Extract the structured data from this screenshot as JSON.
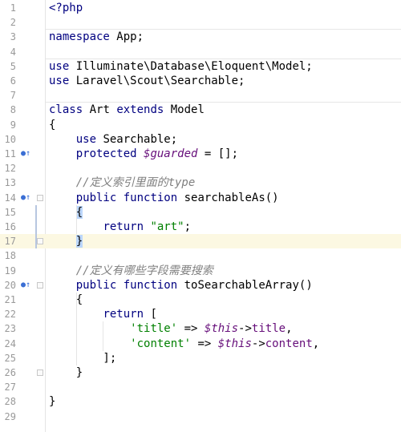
{
  "editor": {
    "current_line": 17,
    "lines": [
      {
        "n": "1",
        "tokens": [
          {
            "t": "<?php",
            "c": "kw"
          }
        ]
      },
      {
        "n": "2",
        "tokens": []
      },
      {
        "n": "3",
        "tokens": [
          {
            "t": "namespace",
            "c": "kw"
          },
          {
            "t": " App;",
            "c": ""
          }
        ]
      },
      {
        "n": "4",
        "tokens": []
      },
      {
        "n": "5",
        "tokens": [
          {
            "t": "use",
            "c": "kw"
          },
          {
            "t": " Illuminate\\Database\\Eloquent\\Model;",
            "c": ""
          }
        ]
      },
      {
        "n": "6",
        "tokens": [
          {
            "t": "use",
            "c": "kw"
          },
          {
            "t": " Laravel\\Scout\\Searchable;",
            "c": ""
          }
        ]
      },
      {
        "n": "7",
        "tokens": []
      },
      {
        "n": "8",
        "tokens": [
          {
            "t": "class",
            "c": "kw"
          },
          {
            "t": " Art ",
            "c": ""
          },
          {
            "t": "extends",
            "c": "kw"
          },
          {
            "t": " Model",
            "c": ""
          }
        ]
      },
      {
        "n": "9",
        "tokens": [
          {
            "t": "{",
            "c": ""
          }
        ]
      },
      {
        "n": "10",
        "tokens": [
          {
            "t": "    ",
            "c": ""
          },
          {
            "t": "use",
            "c": "kw"
          },
          {
            "t": " Searchable;",
            "c": ""
          }
        ]
      },
      {
        "n": "11",
        "marker": "override",
        "tokens": [
          {
            "t": "    ",
            "c": ""
          },
          {
            "t": "protected",
            "c": "kw"
          },
          {
            "t": " ",
            "c": ""
          },
          {
            "t": "$guarded",
            "c": "var"
          },
          {
            "t": " = [];",
            "c": ""
          }
        ]
      },
      {
        "n": "12",
        "tokens": []
      },
      {
        "n": "13",
        "tokens": [
          {
            "t": "    ",
            "c": ""
          },
          {
            "t": "//定义索引里面的type",
            "c": "cmt"
          }
        ]
      },
      {
        "n": "14",
        "marker": "override",
        "fold": true,
        "tokens": [
          {
            "t": "    ",
            "c": ""
          },
          {
            "t": "public",
            "c": "kw"
          },
          {
            "t": " ",
            "c": ""
          },
          {
            "t": "function",
            "c": "kw"
          },
          {
            "t": " searchableAs()",
            "c": ""
          }
        ]
      },
      {
        "n": "15",
        "tokens": [
          {
            "t": "    ",
            "c": ""
          },
          {
            "t": "{",
            "c": "hl"
          }
        ]
      },
      {
        "n": "16",
        "tokens": [
          {
            "t": "        ",
            "c": ""
          },
          {
            "t": "return",
            "c": "kw"
          },
          {
            "t": " ",
            "c": ""
          },
          {
            "t": "\"art\"",
            "c": "str"
          },
          {
            "t": ";",
            "c": ""
          }
        ]
      },
      {
        "n": "17",
        "fold": true,
        "tokens": [
          {
            "t": "    ",
            "c": ""
          },
          {
            "t": "}",
            "c": "hl"
          }
        ]
      },
      {
        "n": "18",
        "tokens": []
      },
      {
        "n": "19",
        "tokens": [
          {
            "t": "    ",
            "c": ""
          },
          {
            "t": "//定义有哪些字段需要搜索",
            "c": "cmt"
          }
        ]
      },
      {
        "n": "20",
        "marker": "override",
        "fold": true,
        "tokens": [
          {
            "t": "    ",
            "c": ""
          },
          {
            "t": "public",
            "c": "kw"
          },
          {
            "t": " ",
            "c": ""
          },
          {
            "t": "function",
            "c": "kw"
          },
          {
            "t": " toSearchableArray()",
            "c": ""
          }
        ]
      },
      {
        "n": "21",
        "tokens": [
          {
            "t": "    {",
            "c": ""
          }
        ]
      },
      {
        "n": "22",
        "tokens": [
          {
            "t": "        ",
            "c": ""
          },
          {
            "t": "return",
            "c": "kw"
          },
          {
            "t": " [",
            "c": ""
          }
        ]
      },
      {
        "n": "23",
        "tokens": [
          {
            "t": "            ",
            "c": ""
          },
          {
            "t": "'title'",
            "c": "str"
          },
          {
            "t": " => ",
            "c": ""
          },
          {
            "t": "$this",
            "c": "var"
          },
          {
            "t": "->",
            "c": ""
          },
          {
            "t": "title",
            "c": "prop"
          },
          {
            "t": ",",
            "c": ""
          }
        ]
      },
      {
        "n": "24",
        "tokens": [
          {
            "t": "            ",
            "c": ""
          },
          {
            "t": "'content'",
            "c": "str"
          },
          {
            "t": " => ",
            "c": ""
          },
          {
            "t": "$this",
            "c": "var"
          },
          {
            "t": "->",
            "c": ""
          },
          {
            "t": "content",
            "c": "prop"
          },
          {
            "t": ",",
            "c": ""
          }
        ]
      },
      {
        "n": "25",
        "tokens": [
          {
            "t": "        ];",
            "c": ""
          }
        ]
      },
      {
        "n": "26",
        "fold": true,
        "tokens": [
          {
            "t": "    }",
            "c": ""
          }
        ]
      },
      {
        "n": "27",
        "tokens": []
      },
      {
        "n": "28",
        "tokens": [
          {
            "t": "}",
            "c": ""
          }
        ]
      },
      {
        "n": "29",
        "tokens": []
      }
    ]
  },
  "icons": {
    "override_marker": "override-arrow-icon",
    "fold_marker": "fold-icon"
  }
}
